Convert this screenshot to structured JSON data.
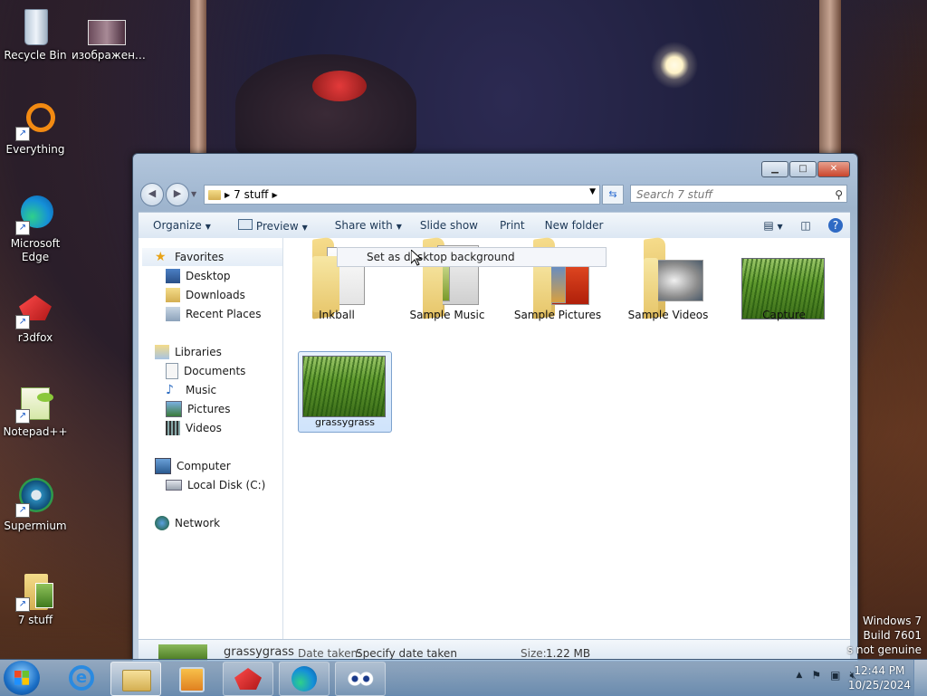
{
  "desktop": {
    "icons": [
      {
        "label": "Recycle Bin"
      },
      {
        "label": "изображен…"
      },
      {
        "label": "Everything"
      },
      {
        "label": "Microsoft Edge"
      },
      {
        "label": "r3dfox"
      },
      {
        "label": "Notepad++"
      },
      {
        "label": "Supermium"
      },
      {
        "label": "7 stuff"
      }
    ],
    "watermark": {
      "line1": "Windows 7",
      "line2": "Build 7601",
      "line3": "s not genuine"
    }
  },
  "window": {
    "address": {
      "folder": "7 stuff"
    },
    "search": {
      "placeholder": "Search 7 stuff"
    },
    "toolbar": {
      "organize": "Organize",
      "preview": "Preview",
      "share_with": "Share with",
      "slide_show": "Slide show",
      "print": "Print",
      "new_folder": "New folder"
    },
    "nav": {
      "favorites": "Favorites",
      "desktop": "Desktop",
      "downloads": "Downloads",
      "recent_places": "Recent Places",
      "libraries": "Libraries",
      "documents": "Documents",
      "music": "Music",
      "pictures": "Pictures",
      "videos": "Videos",
      "computer": "Computer",
      "local_disk": "Local Disk (C:)",
      "network": "Network"
    },
    "items": [
      {
        "name": "Inkball"
      },
      {
        "name": "Sample Music"
      },
      {
        "name": "Sample Pictures"
      },
      {
        "name": "Sample Videos"
      },
      {
        "name": "Capture"
      },
      {
        "name": "grassygrass"
      }
    ],
    "tooltip": "Set as desktop background",
    "details": {
      "name": "grassygrass",
      "date_label": "Date taken:",
      "date_value": "Specify date taken",
      "size_label": "Size:",
      "size_value": "1.22 MB"
    }
  },
  "taskbar": {
    "time": "12:44 PM",
    "date": "10/25/2024"
  }
}
